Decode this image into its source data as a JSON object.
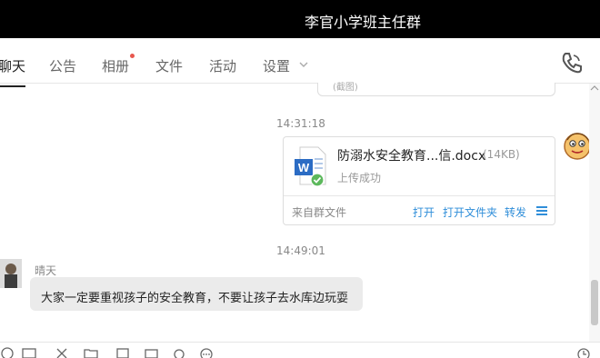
{
  "window": {
    "title": "李官小学班主任群"
  },
  "tabs": [
    {
      "label": "聊天"
    },
    {
      "label": "公告"
    },
    {
      "label": "相册"
    },
    {
      "label": "文件"
    },
    {
      "label": "活动"
    },
    {
      "label": "设置"
    }
  ],
  "colors": {
    "accent_link": "#2f8ed9",
    "unread_dot": "#e8574e",
    "titlebar": "#000000",
    "bubble_bg": "#ebebeb"
  },
  "messages": {
    "prev_card_text": "(截图)",
    "file_time": "14:31:18",
    "file": {
      "name": "防溺水安全教育...信.docx",
      "size": "(14KB)",
      "status": "上传成功",
      "source": "来自群文件",
      "actions": {
        "open": "打开",
        "open_folder": "打开文件夹",
        "forward": "转发"
      }
    },
    "text_time": "14:49:01",
    "sender_name": "晴天",
    "text": "大家一定要重视孩子的安全教育，不要让孩子去水库边玩耍"
  },
  "icons": [
    "phone-icon",
    "chevron-down-icon",
    "word-file-icon",
    "check-icon",
    "menu-icon",
    "emoji-icon",
    "screenshot-icon",
    "scissors-icon",
    "folder-icon",
    "image-icon",
    "search-icon",
    "more-icon",
    "clock-icon"
  ]
}
